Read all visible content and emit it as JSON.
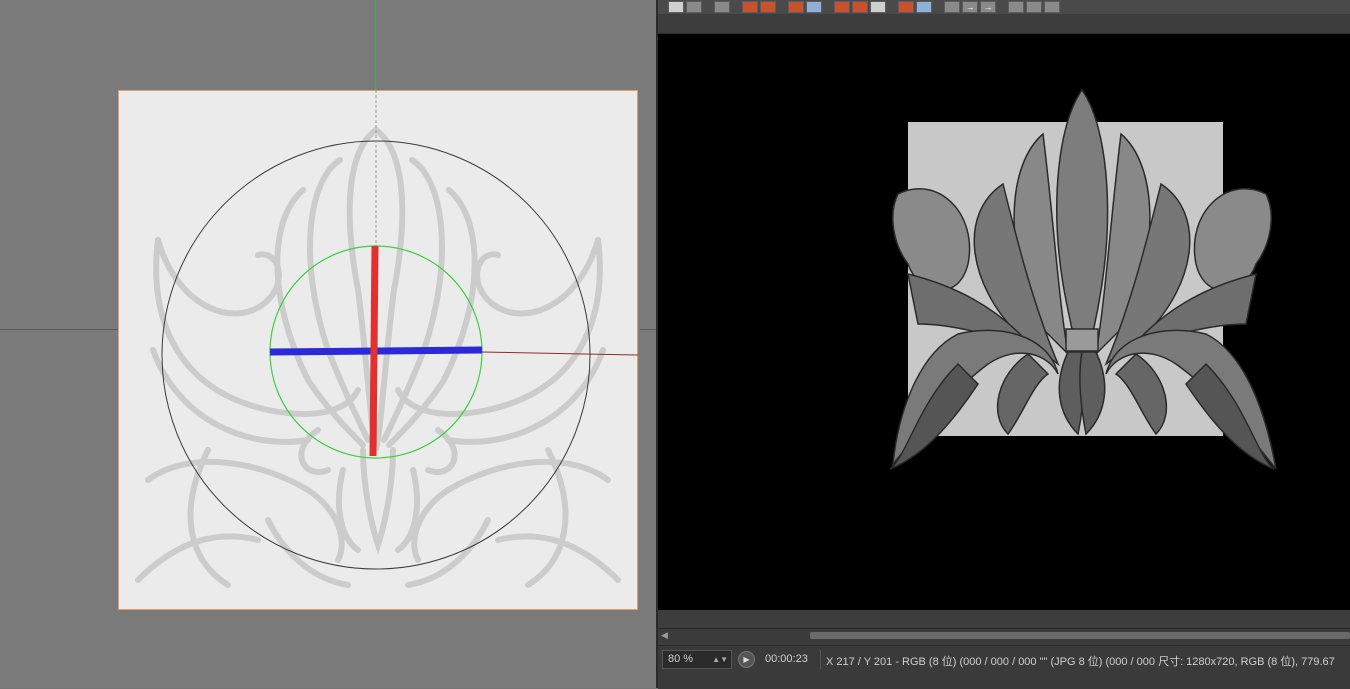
{
  "viewer": {
    "zoom_value": "80 %",
    "timecode": "00:00:23",
    "pixel_info": "X 217 / Y 201 - RGB (8 位) (000 / 000 / 000 \"\" (JPG 8 位) (000 / 000 尺寸: 1280x720, RGB (8 位), 779.67"
  },
  "toolbar": {
    "buttons": [
      {
        "name": "eraser-icon"
      },
      {
        "name": "lock-icon"
      },
      {
        "name": "fit-icon"
      },
      {
        "name": "stop-red-icon"
      },
      {
        "name": "stop-red-2-icon"
      },
      {
        "name": "channel-icon"
      },
      {
        "name": "layers-icon"
      },
      {
        "name": "eye-red-icon"
      },
      {
        "name": "eye-red-2-icon"
      },
      {
        "name": "eye-icon"
      },
      {
        "name": "compare-icon"
      },
      {
        "name": "compare-2-icon"
      },
      {
        "name": "lut-icon"
      },
      {
        "name": "arrow-right-icon"
      },
      {
        "name": "arrow-right-2-icon"
      },
      {
        "name": "panel-icon"
      },
      {
        "name": "panel-2-icon"
      },
      {
        "name": "panel-3-icon"
      }
    ]
  },
  "colors": {
    "gizmo_x": "#e03030",
    "gizmo_z": "#2a2ad8",
    "gizmo_ring": "#3ccf3c",
    "panel_border": "#e3a06b"
  }
}
